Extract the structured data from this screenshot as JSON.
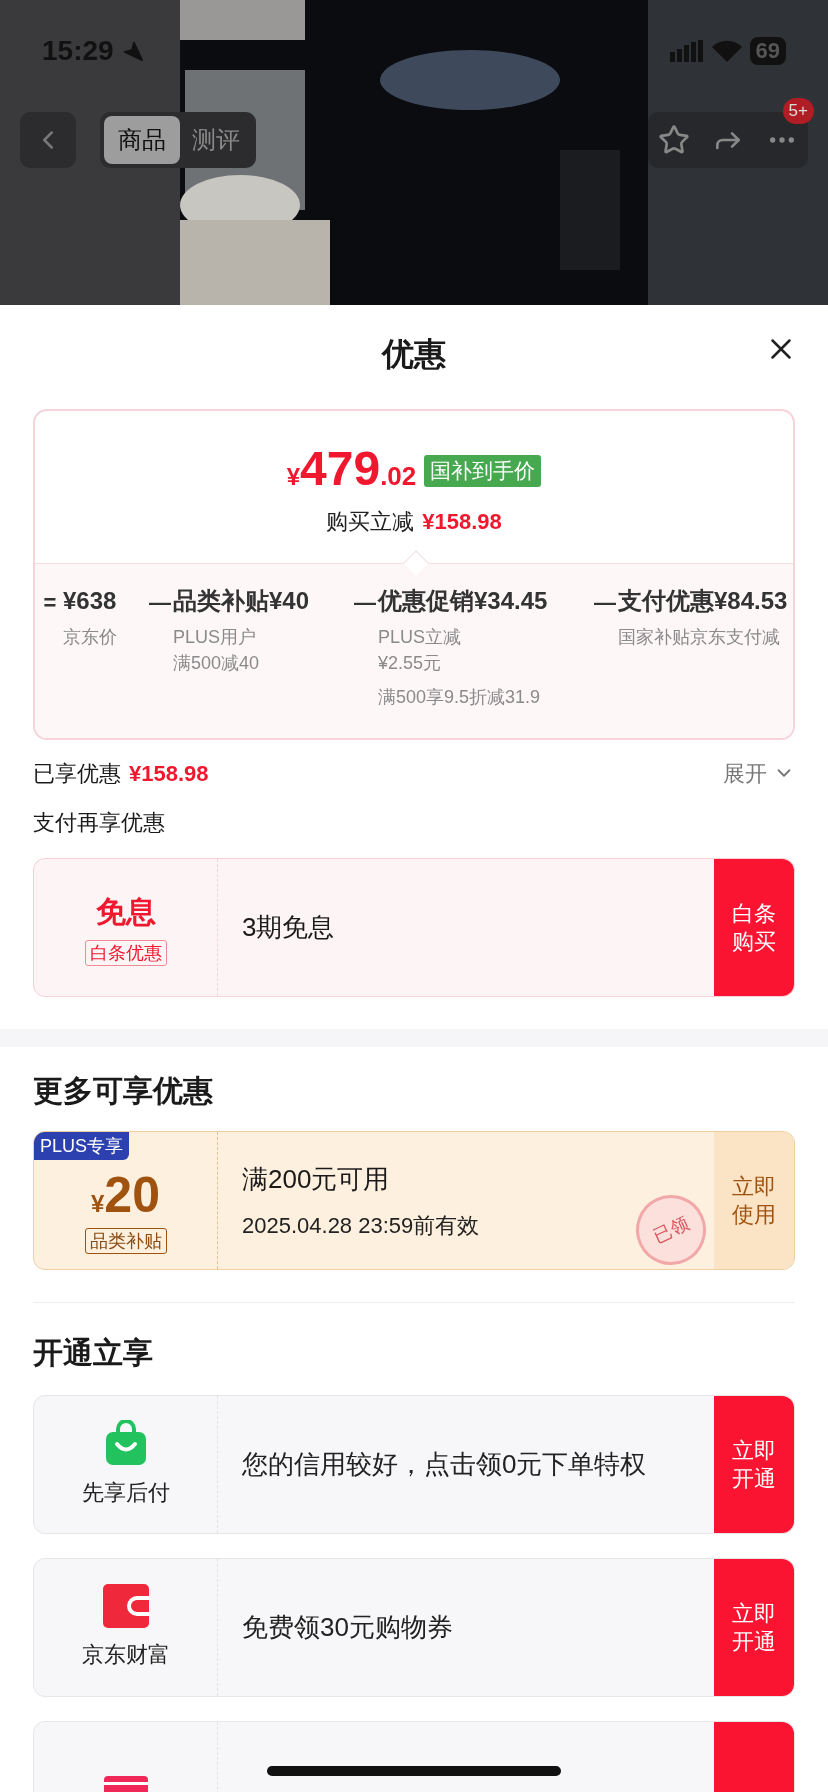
{
  "status_bar": {
    "time": "15:29",
    "battery": "69"
  },
  "nav": {
    "tabs": [
      {
        "label": "商品",
        "selected": true
      },
      {
        "label": "测评",
        "selected": false
      }
    ],
    "badge": "5+"
  },
  "sheet": {
    "title": "优惠"
  },
  "price_card": {
    "currency": "¥",
    "integer": "479",
    "decimal": ".02",
    "tag": "国补到手价",
    "saving_label": "购买立减",
    "saving_value": "¥158.98",
    "breakdown": [
      {
        "operator": "=",
        "title": "¥638",
        "notes": [
          [
            "京东价"
          ]
        ]
      },
      {
        "operator": "—",
        "title": "品类补贴¥40",
        "notes": [
          [
            "PLUS用户",
            "满500减40"
          ]
        ]
      },
      {
        "operator": "—",
        "title": "优惠促销¥34.45",
        "notes": [
          [
            "PLUS立减",
            "¥2.55元"
          ],
          [
            "满500享9.5折减31.9"
          ]
        ]
      },
      {
        "operator": "—",
        "title": "支付优惠¥84.53",
        "notes": [
          [
            "国家补贴京东支付减"
          ]
        ]
      }
    ]
  },
  "enjoyed": {
    "label": "已享优惠",
    "value": "¥158.98",
    "expand": "展开"
  },
  "pay_section": {
    "title": "支付再享优惠",
    "card": {
      "headline": "免息",
      "tag": "白条优惠",
      "text": "3期免息",
      "button": "白条购买"
    }
  },
  "more_section": {
    "title": "更多可享优惠",
    "coupon": {
      "badge": "PLUS专享",
      "currency": "¥",
      "amount": "20",
      "tag": "品类补贴",
      "condition": "满200元可用",
      "validity": "2025.04.28 23:59前有效",
      "button": "立即使用",
      "stamp": "已领"
    }
  },
  "open_section": {
    "title": "开通立享",
    "items": [
      {
        "kind": "bag",
        "name": "先享后付",
        "text": "您的信用较好，点击领0元下单特权",
        "button": "立即开通"
      },
      {
        "kind": "wallet",
        "name": "京东财富",
        "text": "免费领30元购物券",
        "button": "立即开通"
      },
      {
        "kind": "card"
      }
    ]
  }
}
